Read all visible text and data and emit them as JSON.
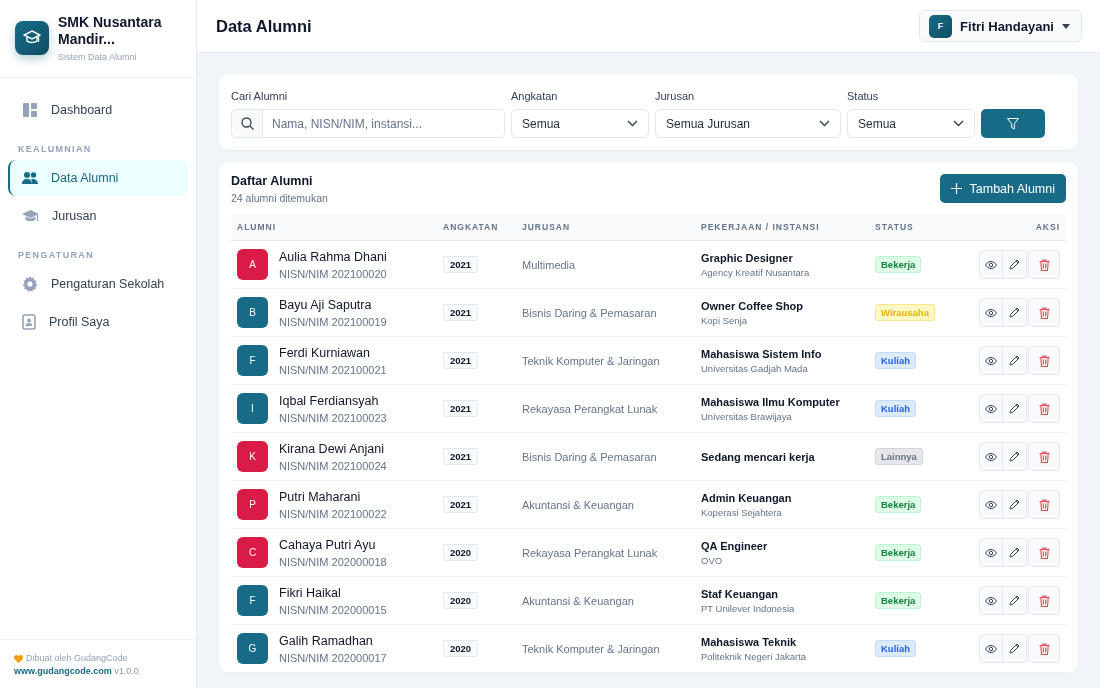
{
  "sidebar": {
    "brand": {
      "name": "SMK Nusantara Mandir...",
      "subtitle": "Sistem Data Alumni"
    },
    "sections": [
      {
        "items": [
          {
            "label": "Dashboard",
            "kind": "dashboard",
            "selected": false
          }
        ]
      },
      {
        "heading": "KEALUMNIAN",
        "items": [
          {
            "label": "Data Alumni",
            "kind": "users",
            "selected": true
          },
          {
            "label": "Jurusan",
            "kind": "graduation",
            "selected": false
          }
        ]
      },
      {
        "heading": "PENGATURAN",
        "items": [
          {
            "label": "Pengaturan Sekolah",
            "kind": "gear",
            "selected": false
          },
          {
            "label": "Profil Saya",
            "kind": "profile",
            "selected": false
          }
        ]
      }
    ],
    "footer": {
      "credit": "Dibuat oleh GudangCode",
      "link": "www.gudangcode.com",
      "version": "v1.0.0"
    }
  },
  "header": {
    "title": "Data Alumni",
    "user": {
      "initial": "F",
      "name": "Fitri Handayani"
    }
  },
  "filters": {
    "search": {
      "label": "Cari Alumni",
      "placeholder": "Nama, NISN/NIM, instansi..."
    },
    "selects": [
      {
        "label": "Angkatan",
        "value": "Semua"
      },
      {
        "label": "Jurusan",
        "value": "Semua Jurusan"
      },
      {
        "label": "Status",
        "value": "Semua"
      }
    ]
  },
  "table": {
    "title": "Daftar Alumni",
    "count": "24 alumni ditemukan",
    "add_button": "Tambah Alumni",
    "columns": [
      "ALUMNI",
      "ANGKATAN",
      "JURUSAN",
      "PEKERJAAN / INSTANSI",
      "STATUS",
      "AKSI"
    ],
    "rows": [
      {
        "initial": "A",
        "color": "#d81b47",
        "name": "Aulia Rahma Dhani",
        "id": "NISN/NIM 202100020",
        "year": "2021",
        "major": "Multimedia",
        "job": "Graphic Designer",
        "company": "Agency Kreatif Nusantara",
        "status": {
          "label": "Bekerja",
          "kind": "work"
        }
      },
      {
        "initial": "B",
        "color": "#176b87",
        "name": "Bayu Aji Saputra",
        "id": "NISN/NIM 202100019",
        "year": "2021",
        "major": "Bisnis Daring & Pemasaran",
        "job": "Owner Coffee Shop",
        "company": "Kopi Senja",
        "status": {
          "label": "Wirausaha",
          "kind": "business"
        }
      },
      {
        "initial": "F",
        "color": "#176b87",
        "name": "Ferdi Kurniawan",
        "id": "NISN/NIM 202100021",
        "year": "2021",
        "major": "Teknik Komputer & Jaringan",
        "job": "Mahasiswa Sistem Info",
        "company": "Universitas Gadjah Mada",
        "status": {
          "label": "Kuliah",
          "kind": "study"
        }
      },
      {
        "initial": "I",
        "color": "#176b87",
        "name": "Iqbal Ferdiansyah",
        "id": "NISN/NIM 202100023",
        "year": "2021",
        "major": "Rekayasa Perangkat Lunak",
        "job": "Mahasiswa Ilmu Komputer",
        "company": "Universitas Brawijaya",
        "status": {
          "label": "Kuliah",
          "kind": "study"
        }
      },
      {
        "initial": "K",
        "color": "#d81b47",
        "name": "Kirana Dewi Anjani",
        "id": "NISN/NIM 202100024",
        "year": "2021",
        "major": "Bisnis Daring & Pemasaran",
        "job": "Sedang mencari kerja",
        "company": null,
        "status": {
          "label": "Lainnya",
          "kind": "other"
        }
      },
      {
        "initial": "P",
        "color": "#d81b47",
        "name": "Putri Maharani",
        "id": "NISN/NIM 202100022",
        "year": "2021",
        "major": "Akuntansi & Keuangan",
        "job": "Admin Keuangan",
        "company": "Koperasi Sejahtera",
        "status": {
          "label": "Bekerja",
          "kind": "work"
        }
      },
      {
        "initial": "C",
        "color": "#d81b47",
        "name": "Cahaya Putri Ayu",
        "id": "NISN/NIM 202000018",
        "year": "2020",
        "major": "Rekayasa Perangkat Lunak",
        "job": "QA Engineer",
        "company": "OVO",
        "status": {
          "label": "Bekerja",
          "kind": "work"
        }
      },
      {
        "initial": "F",
        "color": "#176b87",
        "name": "Fikri Haikal",
        "id": "NISN/NIM 202000015",
        "year": "2020",
        "major": "Akuntansi & Keuangan",
        "job": "Staf Keuangan",
        "company": "PT Unilever Indonesia",
        "status": {
          "label": "Bekerja",
          "kind": "work"
        }
      },
      {
        "initial": "G",
        "color": "#176b87",
        "name": "Galih Ramadhan",
        "id": "NISN/NIM 202000017",
        "year": "2020",
        "major": "Teknik Komputer & Jaringan",
        "job": "Mahasiswa Teknik",
        "company": "Politeknik Negeri Jakarta",
        "status": {
          "label": "Kuliah",
          "kind": "study"
        }
      }
    ]
  }
}
